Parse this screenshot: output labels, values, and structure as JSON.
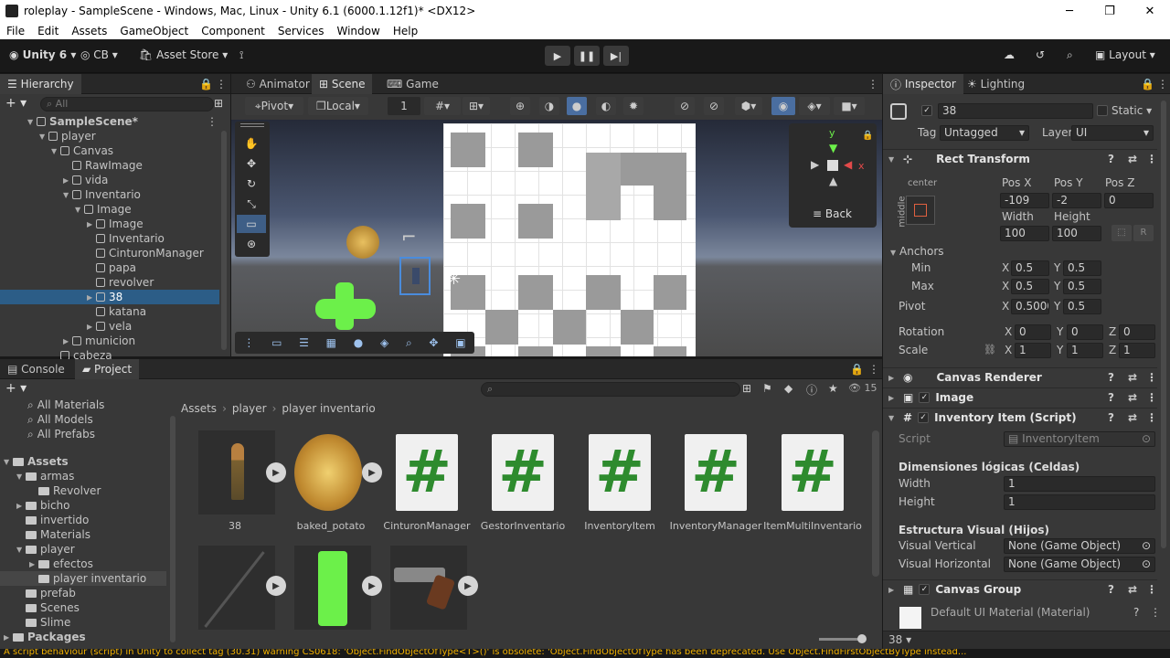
{
  "window": {
    "title": "roleplay - SampleScene - Windows, Mac, Linux - Unity 6.1 (6000.1.12f1)* <DX12>",
    "min": "─",
    "max": "❐",
    "close": "✕"
  },
  "menu": [
    "File",
    "Edit",
    "Assets",
    "GameObject",
    "Component",
    "Services",
    "Window",
    "Help"
  ],
  "toolbar": {
    "unity": "Unity 6",
    "account": "CB",
    "asset_store": "Asset Store",
    "layout": "Layout"
  },
  "hierarchy": {
    "tab": "Hierarchy",
    "search_placeholder": "All",
    "items": [
      {
        "label": "SampleScene*",
        "depth": 0
      },
      {
        "label": "player",
        "depth": 1
      },
      {
        "label": "Canvas",
        "depth": 2
      },
      {
        "label": "RawImage",
        "depth": 3
      },
      {
        "label": "vida",
        "depth": 3
      },
      {
        "label": "Inventario",
        "depth": 3
      },
      {
        "label": "Image",
        "depth": 4
      },
      {
        "label": "Image",
        "depth": 5
      },
      {
        "label": "Inventario",
        "depth": 5
      },
      {
        "label": "CinturonManager",
        "depth": 5
      },
      {
        "label": "papa",
        "depth": 5
      },
      {
        "label": "revolver",
        "depth": 5
      },
      {
        "label": "38",
        "depth": 5
      },
      {
        "label": "katana",
        "depth": 5
      },
      {
        "label": "vela",
        "depth": 5
      },
      {
        "label": "municion",
        "depth": 3
      },
      {
        "label": "cabeza",
        "depth": 2
      }
    ]
  },
  "scene_tabs": [
    "Animator",
    "Scene",
    "Game"
  ],
  "scene_toolbar": {
    "pivot": "Pivot",
    "local": "Local",
    "snap": "1"
  },
  "gizmo": {
    "back": "≡ Back",
    "y": "y",
    "x": "x"
  },
  "bottom_tabs": {
    "console": "Console",
    "project": "Project"
  },
  "project": {
    "breadcrumb": [
      "Assets",
      "player",
      "player inventario"
    ],
    "count": "15",
    "favorites": [
      "All Materials",
      "All Models",
      "All Prefabs"
    ],
    "tree": [
      {
        "label": "Assets",
        "depth": 0
      },
      {
        "label": "armas",
        "depth": 1
      },
      {
        "label": "Revolver",
        "depth": 2
      },
      {
        "label": "bicho",
        "depth": 1
      },
      {
        "label": "invertido",
        "depth": 1
      },
      {
        "label": "Materials",
        "depth": 1
      },
      {
        "label": "player",
        "depth": 1
      },
      {
        "label": "efectos",
        "depth": 2
      },
      {
        "label": "player inventario",
        "depth": 2
      },
      {
        "label": "prefab",
        "depth": 1
      },
      {
        "label": "Scenes",
        "depth": 1
      },
      {
        "label": "Slime",
        "depth": 1
      },
      {
        "label": "Packages",
        "depth": 0
      }
    ],
    "assets": [
      "38",
      "baked_potato",
      "CinturonManager",
      "GestorInventario",
      "InventoryItem",
      "InventoryManager",
      "ItemMultiInventario"
    ],
    "hash": "#"
  },
  "inspector": {
    "tabs": [
      "Inspector",
      "Lighting"
    ],
    "name": "38",
    "static": "Static",
    "tag_label": "Tag",
    "tag": "Untagged",
    "layer_label": "Layer",
    "layer": "UI",
    "rect": {
      "title": "Rect Transform",
      "anchor_h": "center",
      "anchor_v": "middle",
      "posx_label": "Pos X",
      "posy_label": "Pos Y",
      "posz_label": "Pos Z",
      "posx": "-109",
      "posy": "-2",
      "posz": "0",
      "width_label": "Width",
      "height_label": "Height",
      "width": "100",
      "height": "100",
      "r": "R",
      "anchors": "Anchors",
      "min": "Min",
      "max": "Max",
      "min_x": "0.5",
      "min_y": "0.5",
      "max_x": "0.5",
      "max_y": "0.5",
      "pivot": "Pivot",
      "pivot_x": "0.5000",
      "pivot_y": "0.5",
      "rotation": "Rotation",
      "rot_x": "0",
      "rot_y": "0",
      "rot_z": "0",
      "scale": "Scale",
      "scale_x": "1",
      "scale_y": "1",
      "scale_z": "1",
      "x": "X",
      "y": "Y",
      "z": "Z"
    },
    "canvas_renderer": "Canvas Renderer",
    "image": "Image",
    "inventory_item": {
      "title": "Inventory Item (Script)",
      "script_label": "Script",
      "script": "InventoryItem",
      "section1": "Dimensiones lógicas (Celdas)",
      "width_label": "Width",
      "width": "1",
      "height_label": "Height",
      "height": "1",
      "section2": "Estructura Visual (Hijos)",
      "vv_label": "Visual Vertical",
      "vv": "None (Game Object)",
      "vh_label": "Visual Horizontal",
      "vh": "None (Game Object)"
    },
    "canvas_group": "Canvas Group",
    "material": "Default UI Material (Material)",
    "footer": "38"
  },
  "status": "A script behaviour (script) in Unity to collect tag (30.31) warning CS0618: 'Object.FindObjectOfType<T>()' is obsolete: 'Object.FindObjectOfType has been deprecated. Use Object.FindFirstObjectByType instead...",
  "colors": {
    "selection": "#2c5d87",
    "panel": "#383838",
    "header": "#282828",
    "status": "#f0b000"
  }
}
